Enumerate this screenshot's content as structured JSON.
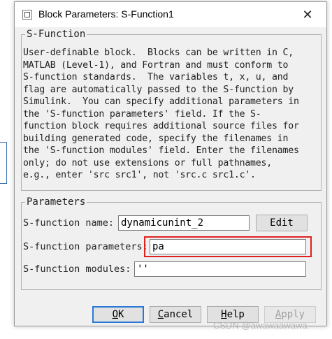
{
  "window": {
    "title": "Block Parameters: S-Function1",
    "close_glyph": "✕"
  },
  "sfunction_group": {
    "title": "S-Function",
    "description": "User-definable block.  Blocks can be written in C,\nMATLAB (Level-1), and Fortran and must conform to\nS-function standards.  The variables t, x, u, and\nflag are automatically passed to the S-function by\nSimulink.  You can specify additional parameters in\nthe 'S-function parameters' field. If the S-\nfunction block requires additional source files for\nbuilding generated code, specify the filenames in\nthe 'S-function modules' field. Enter the filenames\nonly; do not use extensions or full pathnames,\ne.g., enter 'src src1', not 'src.c src1.c'."
  },
  "parameters_group": {
    "title": "Parameters",
    "name_label": "S-function name:",
    "name_value": "dynamicunint_2",
    "edit_label": "Edit",
    "params_label": "S-function parameters:",
    "params_value": "pa",
    "modules_label": "S-function modules:",
    "modules_value": "''"
  },
  "buttons": {
    "ok_first": "O",
    "ok_rest": "K",
    "cancel_first": "C",
    "cancel_rest": "ancel",
    "help_first": "H",
    "help_rest": "elp",
    "apply_first": "A",
    "apply_rest": "pply"
  },
  "watermark": "CSDN @awawaawawa",
  "colors": {
    "highlight": "#e02020",
    "focus_border": "#2b79d6"
  }
}
